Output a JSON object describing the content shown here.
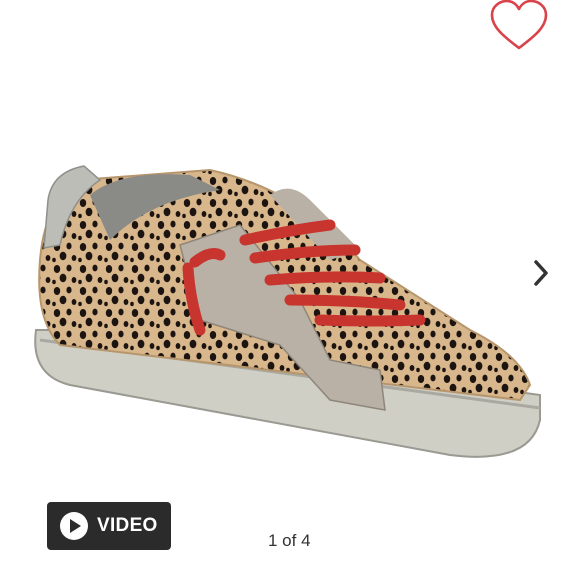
{
  "favorite": {
    "icon": "heart-outline-icon",
    "color": "#d9434a"
  },
  "navigation": {
    "next_icon": "chevron-right-icon"
  },
  "product_image": {
    "subject": "leopard-print-sneaker-red-laces"
  },
  "video_button": {
    "label": "VIDEO",
    "icon": "play-circle-icon"
  },
  "pagination": {
    "counter": "1 of 4"
  },
  "colors": {
    "accent": "#d9434a",
    "button_bg": "#2b2b2b",
    "lace": "#c8342e",
    "fur": "#d7b48a"
  }
}
